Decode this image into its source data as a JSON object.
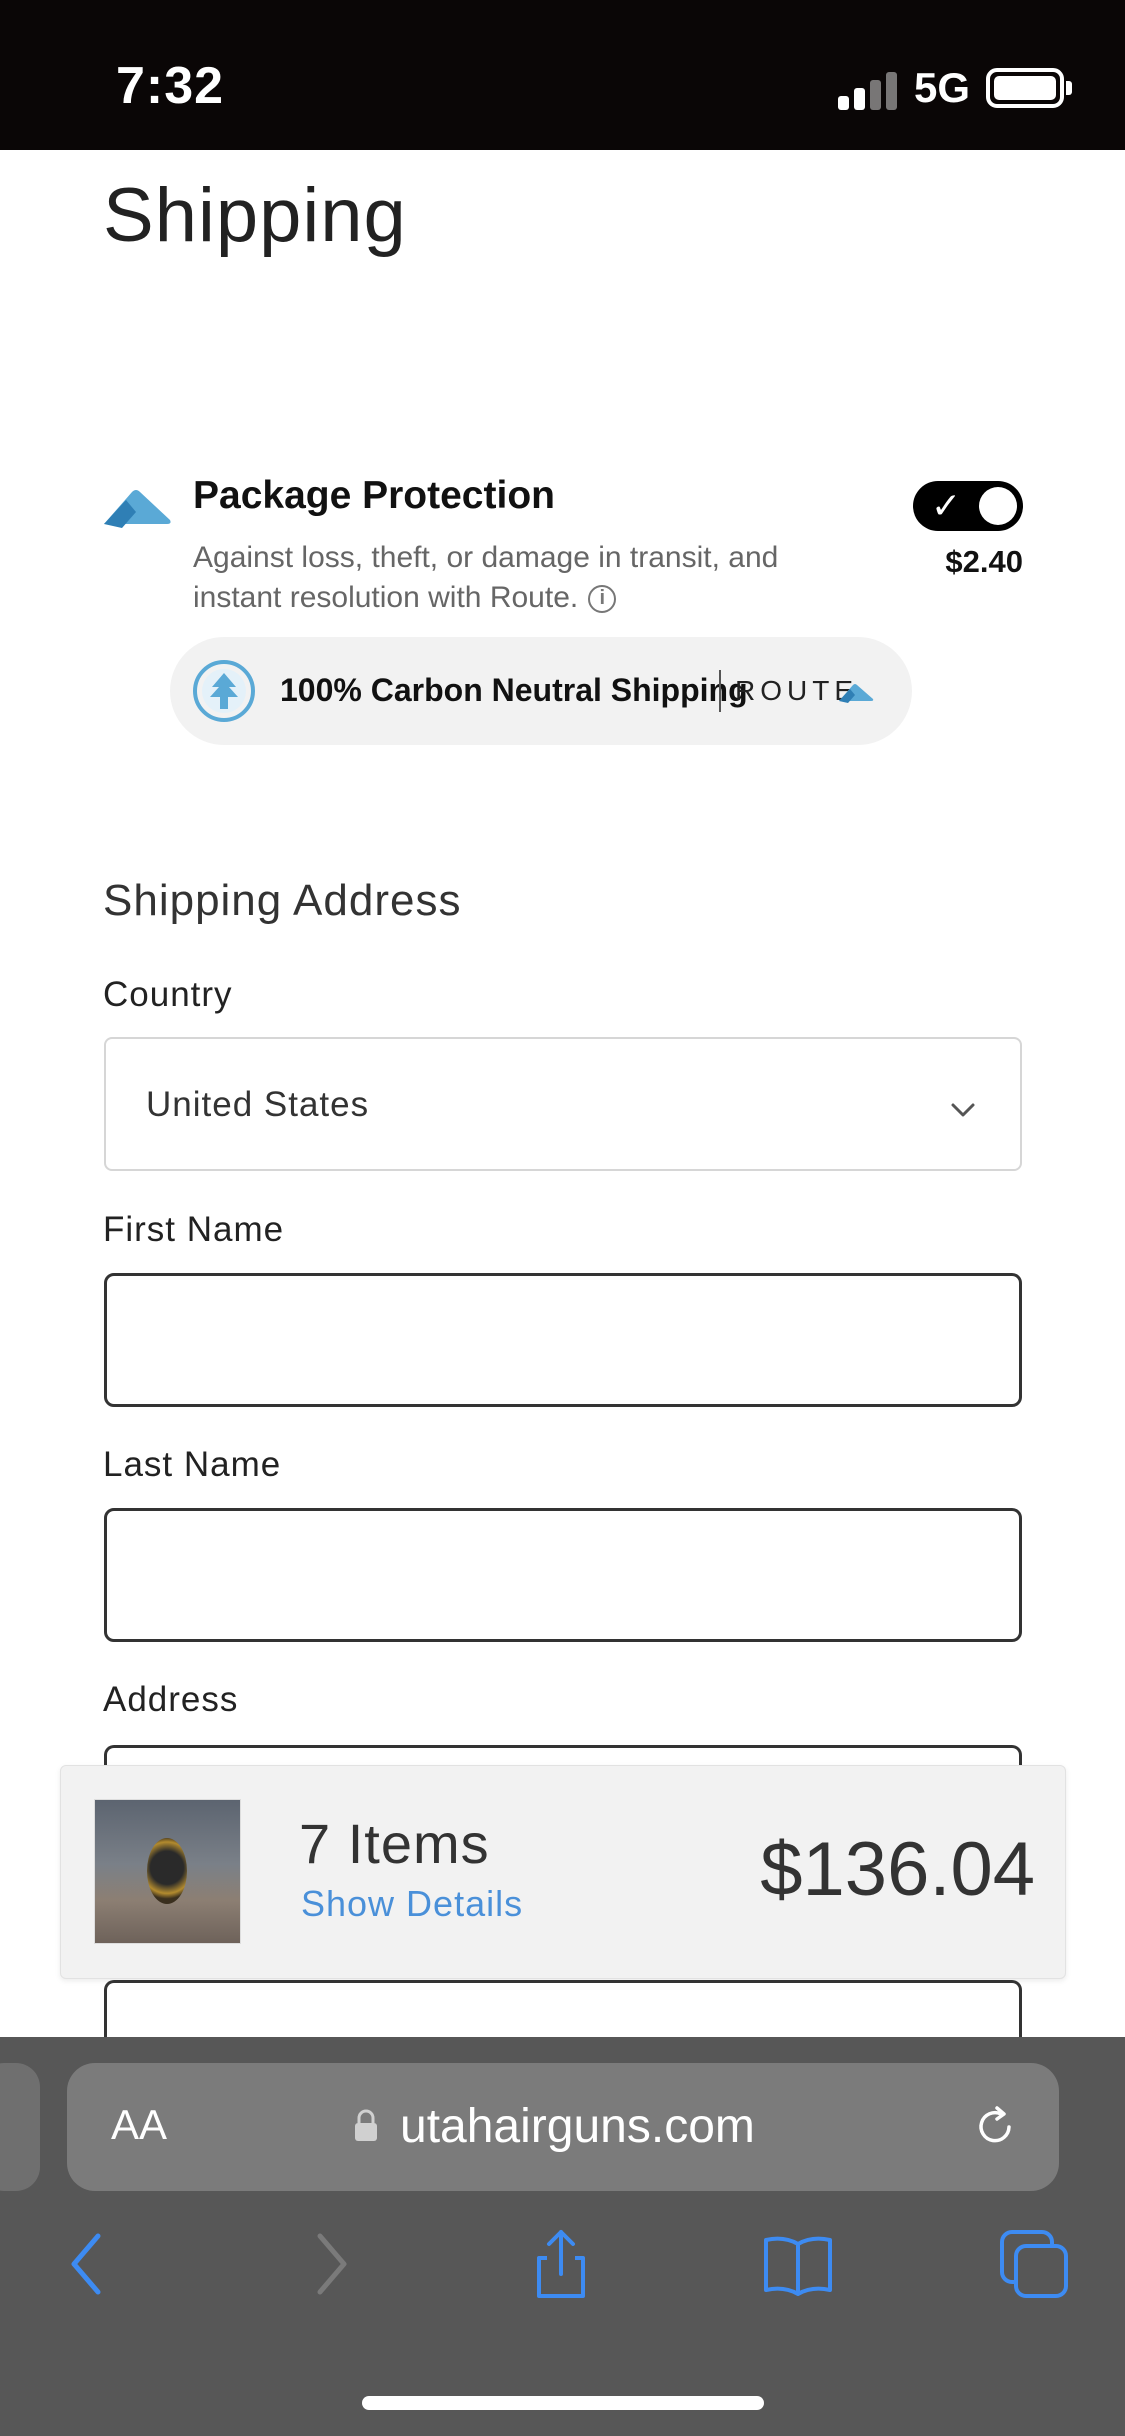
{
  "status_bar": {
    "time": "7:32",
    "network": "5G"
  },
  "page": {
    "title": "Shipping"
  },
  "package_protection": {
    "title": "Package Protection",
    "description": "Against loss, theft, or damage in transit, and instant resolution with Route.",
    "price": "$2.40",
    "enabled": true,
    "carbon_text": "100% Carbon Neutral Shipping",
    "brand": "ROUTE"
  },
  "shipping_address": {
    "section_title": "Shipping Address",
    "country_label": "Country",
    "country_value": "United States",
    "first_name_label": "First Name",
    "first_name_value": "",
    "last_name_label": "Last Name",
    "last_name_value": "",
    "address_label": "Address"
  },
  "summary": {
    "items": "7 Items",
    "show_details": "Show Details",
    "total": "$136.04"
  },
  "browser": {
    "aa_label": "AA",
    "url": "utahairguns.com"
  },
  "colors": {
    "accent_blue": "#4a90d9",
    "route_blue": "#5aa9d6",
    "safari_bar": "#575757"
  }
}
